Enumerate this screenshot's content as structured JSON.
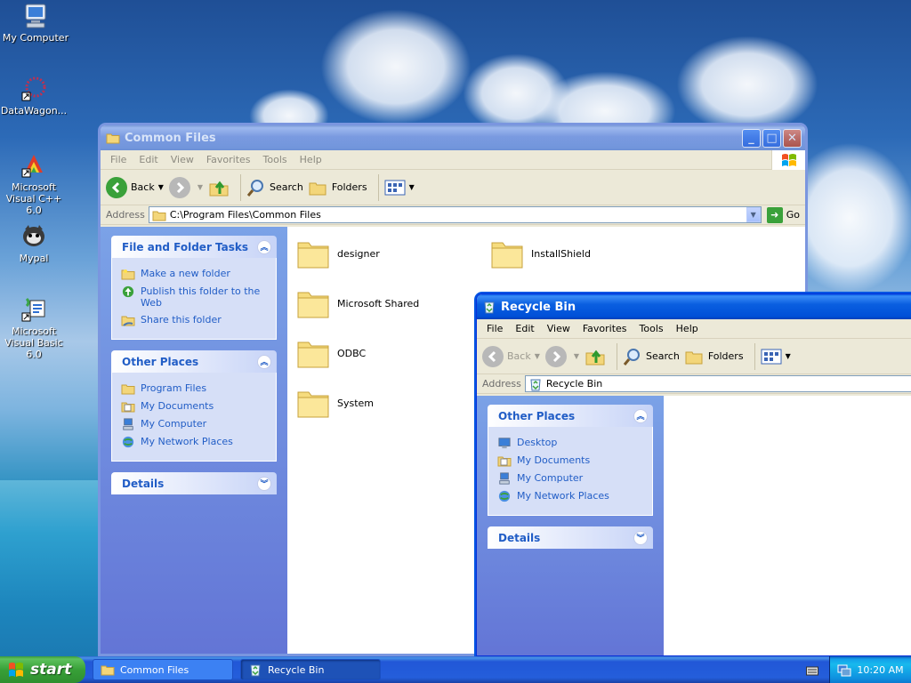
{
  "desktop": {
    "icons": [
      {
        "label": "My Computer",
        "icon": "my-computer-icon"
      },
      {
        "label": "DataWagon...",
        "icon": "datawagon-icon"
      },
      {
        "label": "Microsoft Visual C++ 6.0",
        "icon": "visual-cpp-icon"
      },
      {
        "label": "Mypal",
        "icon": "mypal-icon"
      },
      {
        "label": "Microsoft Visual Basic 6.0",
        "icon": "visual-basic-icon"
      }
    ]
  },
  "common_files_window": {
    "title": "Common Files",
    "menu": [
      "File",
      "Edit",
      "View",
      "Favorites",
      "Tools",
      "Help"
    ],
    "toolbar": {
      "back": "Back",
      "search": "Search",
      "folders": "Folders"
    },
    "address_label": "Address",
    "address": "C:\\Program Files\\Common Files",
    "go": "Go",
    "tasks": {
      "title": "File and Folder Tasks",
      "items": [
        "Make a new folder",
        "Publish this folder to the Web",
        "Share this folder"
      ]
    },
    "other_places": {
      "title": "Other Places",
      "items": [
        "Program Files",
        "My Documents",
        "My Computer",
        "My Network Places"
      ]
    },
    "details": {
      "title": "Details"
    },
    "folders": [
      "designer",
      "InstallShield",
      "Microsoft Shared",
      "ODBC",
      "System"
    ]
  },
  "recycle_bin_window": {
    "title": "Recycle Bin",
    "menu": [
      "File",
      "Edit",
      "View",
      "Favorites",
      "Tools",
      "Help"
    ],
    "toolbar": {
      "back": "Back",
      "search": "Search",
      "folders": "Folders"
    },
    "address_label": "Address",
    "address": "Recycle Bin",
    "other_places": {
      "title": "Other Places",
      "items": [
        "Desktop",
        "My Documents",
        "My Computer",
        "My Network Places"
      ]
    },
    "details": {
      "title": "Details"
    }
  },
  "taskbar": {
    "start": "start",
    "items": [
      "Common Files",
      "Recycle Bin"
    ],
    "clock": "10:20 AM"
  },
  "colors": {
    "xp_blue": "#0054e3",
    "taskpane_link": "#215dc6",
    "start_green": "#38a038"
  }
}
